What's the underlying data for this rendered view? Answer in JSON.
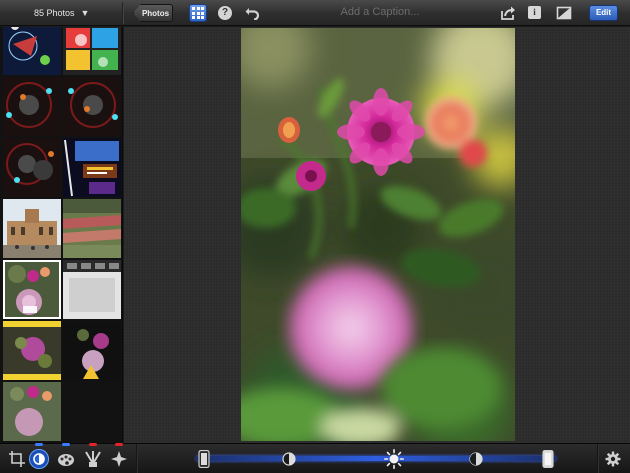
{
  "topbar": {
    "photo_count": "85 Photos",
    "back_label": "Photos",
    "caption_placeholder": "Add a Caption...",
    "help_glyph": "?",
    "info_glyph": "i",
    "edit_label": "Edit",
    "icons": [
      "dropdown-caret-icon",
      "grid-icon",
      "help-icon",
      "undo-icon",
      "share-icon",
      "info-icon",
      "compare-icon"
    ]
  },
  "sidebar": {
    "thumbnails": [
      {
        "subject": "space game screenshot"
      },
      {
        "subject": "colorful game screenshot"
      },
      {
        "subject": "orbit game screenshot"
      },
      {
        "subject": "orbit game screenshot"
      },
      {
        "subject": "orbit game screenshot"
      },
      {
        "subject": "game menu screenshot"
      },
      {
        "subject": "palace photo"
      },
      {
        "subject": "garden photo"
      },
      {
        "subject": "dahlia photo",
        "selected": true
      },
      {
        "subject": "app screenshot"
      },
      {
        "subject": "dahlia edit screenshot"
      },
      {
        "subject": "dahlia dark photo"
      },
      {
        "subject": "dahlia photo"
      }
    ]
  },
  "bottombar": {
    "tools": [
      {
        "name": "crop-tool",
        "icon": "crop-icon",
        "active": false
      },
      {
        "name": "exposure-tool",
        "icon": "exposure-icon",
        "active": true,
        "indicator_color": "#3a7bff"
      },
      {
        "name": "color-tool",
        "icon": "palette-icon",
        "active": false,
        "indicator_color": "#3a7bff"
      },
      {
        "name": "brushes-tool",
        "icon": "brushes-icon",
        "active": false,
        "indicator_color": "#e0242a"
      },
      {
        "name": "effects-tool",
        "icon": "effects-icon",
        "active": false,
        "indicator_color": "#e0242a"
      }
    ],
    "slider_icons": [
      "phone-shadows-icon",
      "shadows-knob-icon",
      "brightness-sun-icon",
      "highlights-knob-icon",
      "phone-highlights-icon"
    ],
    "settings_icon": "gear-icon"
  },
  "colors": {
    "accent_blue": "#2f5ee0",
    "edit_button": "#3f74d0",
    "background": "#2b2b2b"
  }
}
